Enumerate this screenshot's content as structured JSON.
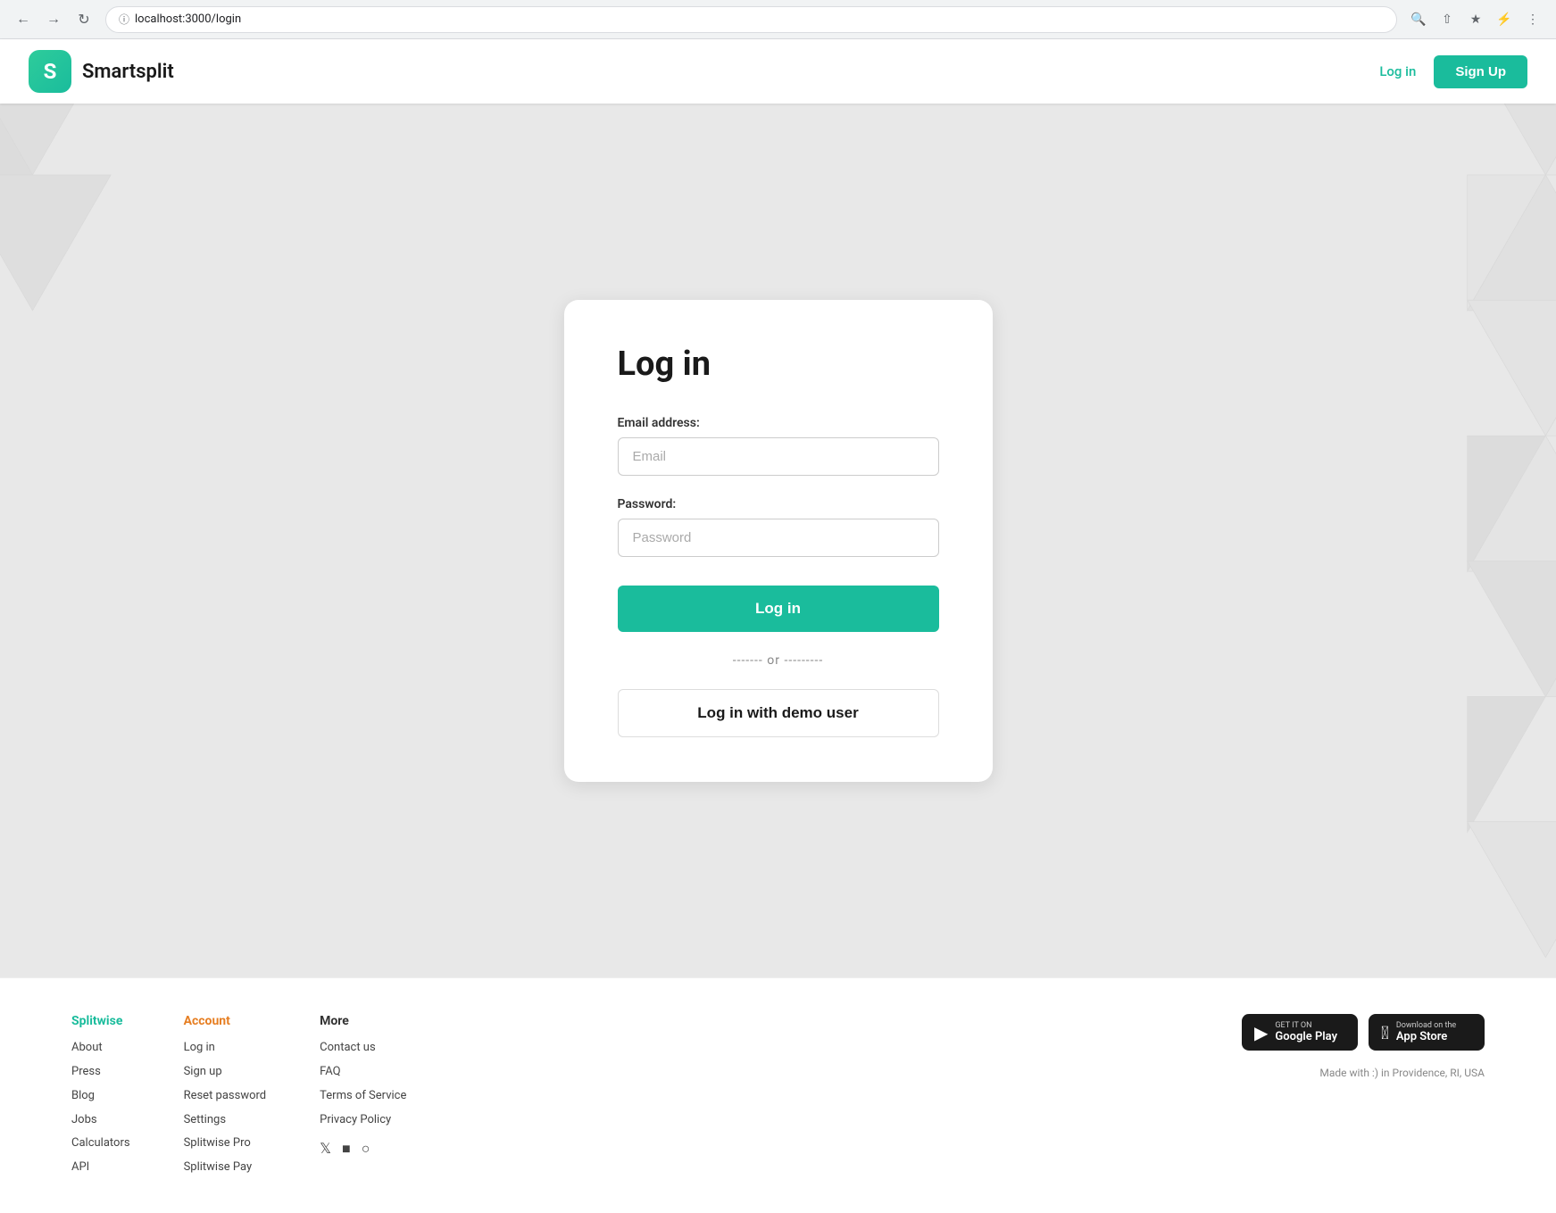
{
  "browser": {
    "url": "localhost:3000/login",
    "back_btn": "←",
    "forward_btn": "→",
    "refresh_btn": "↻"
  },
  "navbar": {
    "logo_letter": "S",
    "app_name": "Smartsplit",
    "login_link": "Log in",
    "signup_btn": "Sign Up"
  },
  "login_card": {
    "title": "Log in",
    "email_label": "Email address:",
    "email_placeholder": "Email",
    "password_label": "Password:",
    "password_placeholder": "Password",
    "login_btn": "Log in",
    "divider": "------- or ---------",
    "demo_btn": "Log in with demo user"
  },
  "footer": {
    "col1": {
      "title": "Splitwise",
      "links": [
        "About",
        "Press",
        "Blog",
        "Jobs",
        "Calculators",
        "API"
      ]
    },
    "col2": {
      "title": "Account",
      "links": [
        "Log in",
        "Sign up",
        "Reset password",
        "Settings",
        "Splitwise Pro",
        "Splitwise Pay"
      ]
    },
    "col3": {
      "title": "More",
      "links": [
        "Contact us",
        "FAQ",
        "Terms of Service",
        "Privacy Policy"
      ]
    },
    "google_play_small": "GET IT ON",
    "google_play_large": "Google Play",
    "app_store_small": "Download on the",
    "app_store_large": "App Store",
    "made_with": "Made with :) in Providence, RI, USA"
  }
}
